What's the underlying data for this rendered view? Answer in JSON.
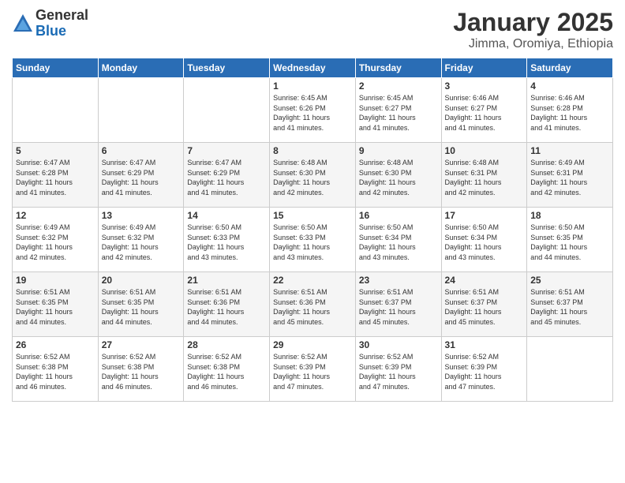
{
  "logo": {
    "general": "General",
    "blue": "Blue"
  },
  "title": "January 2025",
  "subtitle": "Jimma, Oromiya, Ethiopia",
  "days_header": [
    "Sunday",
    "Monday",
    "Tuesday",
    "Wednesday",
    "Thursday",
    "Friday",
    "Saturday"
  ],
  "weeks": [
    [
      {
        "day": "",
        "info": ""
      },
      {
        "day": "",
        "info": ""
      },
      {
        "day": "",
        "info": ""
      },
      {
        "day": "1",
        "info": "Sunrise: 6:45 AM\nSunset: 6:26 PM\nDaylight: 11 hours\nand 41 minutes."
      },
      {
        "day": "2",
        "info": "Sunrise: 6:45 AM\nSunset: 6:27 PM\nDaylight: 11 hours\nand 41 minutes."
      },
      {
        "day": "3",
        "info": "Sunrise: 6:46 AM\nSunset: 6:27 PM\nDaylight: 11 hours\nand 41 minutes."
      },
      {
        "day": "4",
        "info": "Sunrise: 6:46 AM\nSunset: 6:28 PM\nDaylight: 11 hours\nand 41 minutes."
      }
    ],
    [
      {
        "day": "5",
        "info": "Sunrise: 6:47 AM\nSunset: 6:28 PM\nDaylight: 11 hours\nand 41 minutes."
      },
      {
        "day": "6",
        "info": "Sunrise: 6:47 AM\nSunset: 6:29 PM\nDaylight: 11 hours\nand 41 minutes."
      },
      {
        "day": "7",
        "info": "Sunrise: 6:47 AM\nSunset: 6:29 PM\nDaylight: 11 hours\nand 41 minutes."
      },
      {
        "day": "8",
        "info": "Sunrise: 6:48 AM\nSunset: 6:30 PM\nDaylight: 11 hours\nand 42 minutes."
      },
      {
        "day": "9",
        "info": "Sunrise: 6:48 AM\nSunset: 6:30 PM\nDaylight: 11 hours\nand 42 minutes."
      },
      {
        "day": "10",
        "info": "Sunrise: 6:48 AM\nSunset: 6:31 PM\nDaylight: 11 hours\nand 42 minutes."
      },
      {
        "day": "11",
        "info": "Sunrise: 6:49 AM\nSunset: 6:31 PM\nDaylight: 11 hours\nand 42 minutes."
      }
    ],
    [
      {
        "day": "12",
        "info": "Sunrise: 6:49 AM\nSunset: 6:32 PM\nDaylight: 11 hours\nand 42 minutes."
      },
      {
        "day": "13",
        "info": "Sunrise: 6:49 AM\nSunset: 6:32 PM\nDaylight: 11 hours\nand 42 minutes."
      },
      {
        "day": "14",
        "info": "Sunrise: 6:50 AM\nSunset: 6:33 PM\nDaylight: 11 hours\nand 43 minutes."
      },
      {
        "day": "15",
        "info": "Sunrise: 6:50 AM\nSunset: 6:33 PM\nDaylight: 11 hours\nand 43 minutes."
      },
      {
        "day": "16",
        "info": "Sunrise: 6:50 AM\nSunset: 6:34 PM\nDaylight: 11 hours\nand 43 minutes."
      },
      {
        "day": "17",
        "info": "Sunrise: 6:50 AM\nSunset: 6:34 PM\nDaylight: 11 hours\nand 43 minutes."
      },
      {
        "day": "18",
        "info": "Sunrise: 6:50 AM\nSunset: 6:35 PM\nDaylight: 11 hours\nand 44 minutes."
      }
    ],
    [
      {
        "day": "19",
        "info": "Sunrise: 6:51 AM\nSunset: 6:35 PM\nDaylight: 11 hours\nand 44 minutes."
      },
      {
        "day": "20",
        "info": "Sunrise: 6:51 AM\nSunset: 6:35 PM\nDaylight: 11 hours\nand 44 minutes."
      },
      {
        "day": "21",
        "info": "Sunrise: 6:51 AM\nSunset: 6:36 PM\nDaylight: 11 hours\nand 44 minutes."
      },
      {
        "day": "22",
        "info": "Sunrise: 6:51 AM\nSunset: 6:36 PM\nDaylight: 11 hours\nand 45 minutes."
      },
      {
        "day": "23",
        "info": "Sunrise: 6:51 AM\nSunset: 6:37 PM\nDaylight: 11 hours\nand 45 minutes."
      },
      {
        "day": "24",
        "info": "Sunrise: 6:51 AM\nSunset: 6:37 PM\nDaylight: 11 hours\nand 45 minutes."
      },
      {
        "day": "25",
        "info": "Sunrise: 6:51 AM\nSunset: 6:37 PM\nDaylight: 11 hours\nand 45 minutes."
      }
    ],
    [
      {
        "day": "26",
        "info": "Sunrise: 6:52 AM\nSunset: 6:38 PM\nDaylight: 11 hours\nand 46 minutes."
      },
      {
        "day": "27",
        "info": "Sunrise: 6:52 AM\nSunset: 6:38 PM\nDaylight: 11 hours\nand 46 minutes."
      },
      {
        "day": "28",
        "info": "Sunrise: 6:52 AM\nSunset: 6:38 PM\nDaylight: 11 hours\nand 46 minutes."
      },
      {
        "day": "29",
        "info": "Sunrise: 6:52 AM\nSunset: 6:39 PM\nDaylight: 11 hours\nand 47 minutes."
      },
      {
        "day": "30",
        "info": "Sunrise: 6:52 AM\nSunset: 6:39 PM\nDaylight: 11 hours\nand 47 minutes."
      },
      {
        "day": "31",
        "info": "Sunrise: 6:52 AM\nSunset: 6:39 PM\nDaylight: 11 hours\nand 47 minutes."
      },
      {
        "day": "",
        "info": ""
      }
    ]
  ]
}
